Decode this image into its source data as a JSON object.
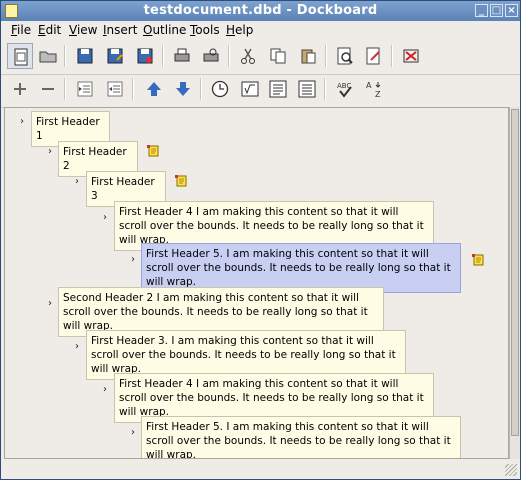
{
  "window": {
    "title": "testdocument.dbd - Dockboard"
  },
  "menu": {
    "items": [
      "File",
      "Edit",
      "View",
      "Insert",
      "Outline",
      "Tools",
      "Help"
    ]
  },
  "toolbar1": {
    "icons": [
      "new-document-icon",
      "open-folder-icon",
      "save-icon",
      "save-as-icon",
      "print-icon",
      "print-preview-icon",
      "cut-icon",
      "copy-icon",
      "paste-icon",
      "find-icon",
      "find-replace-icon",
      "exit-icon"
    ]
  },
  "toolbar2": {
    "icons": [
      "add-icon",
      "remove-icon",
      "indent-icon",
      "outdent-icon",
      "move-up-icon",
      "move-down-icon",
      "clock-icon",
      "formula-icon",
      "text-align-icon",
      "text-justify-icon",
      "spell-check-icon",
      "sort-az-icon"
    ]
  },
  "outline": {
    "nodes": [
      {
        "text": "First Header 1",
        "selected": false,
        "has_note": false
      },
      {
        "text": "First Header 2",
        "selected": false,
        "has_note": true
      },
      {
        "text": "First Header 3",
        "selected": false,
        "has_note": true
      },
      {
        "text": "First Header 4 I am making this content so that it will scroll over the bounds. It needs to be really long so that it will wrap.",
        "selected": false,
        "has_note": false
      },
      {
        "text": "First Header 5. I am making this content so that it will scroll over the bounds. It needs to be really long so that it will wrap.",
        "selected": true,
        "has_note": true
      },
      {
        "text": "Second Header 2 I am making this content so that it will scroll over the bounds. It needs to be really long so that it will wrap.",
        "selected": false,
        "has_note": false
      },
      {
        "text": "First Header 3. I am making this content so that it will scroll over the bounds. It needs to be really long so that it will wrap.",
        "selected": false,
        "has_note": false
      },
      {
        "text": "First Header 4 I am making this content so that it will scroll over the bounds. It needs to be really long so that it will wrap.",
        "selected": false,
        "has_note": false
      },
      {
        "text": "First Header 5. I am making this content so that it will scroll over the bounds. It needs to be really long so that it will wrap.",
        "selected": false,
        "has_note": false
      }
    ]
  },
  "colors": {
    "titlebar": "#5a82b6",
    "node_bg": "#fffce6",
    "node_selected_bg": "#c9cff2"
  }
}
